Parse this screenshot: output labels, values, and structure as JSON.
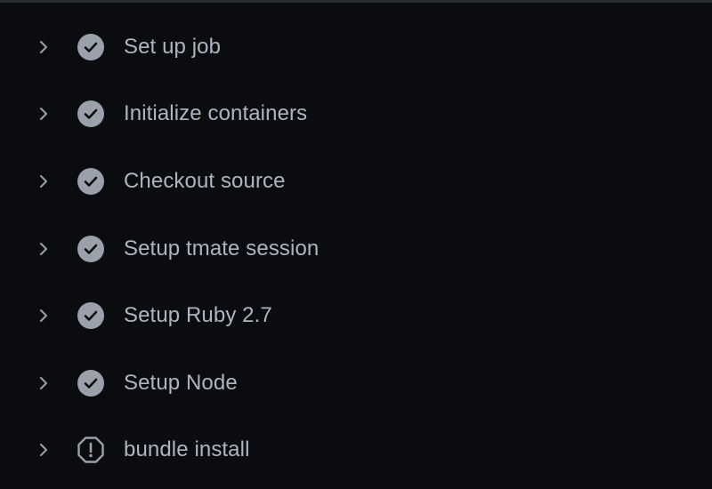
{
  "steps": [
    {
      "label": "Set up job",
      "status": "success",
      "icon": "check-circle-icon"
    },
    {
      "label": "Initialize containers",
      "status": "success",
      "icon": "check-circle-icon"
    },
    {
      "label": "Checkout source",
      "status": "success",
      "icon": "check-circle-icon"
    },
    {
      "label": "Setup tmate session",
      "status": "success",
      "icon": "check-circle-icon"
    },
    {
      "label": "Setup Ruby 2.7",
      "status": "success",
      "icon": "check-circle-icon"
    },
    {
      "label": "Setup Node",
      "status": "success",
      "icon": "check-circle-icon"
    },
    {
      "label": "bundle install",
      "status": "pending",
      "icon": "alert-octagon-icon"
    }
  ],
  "colors": {
    "background": "#0b0c10",
    "text": "#adb5c0",
    "icon": "#9aa1ab",
    "chevron": "#9aa1ab",
    "divider": "#2b2e35"
  }
}
